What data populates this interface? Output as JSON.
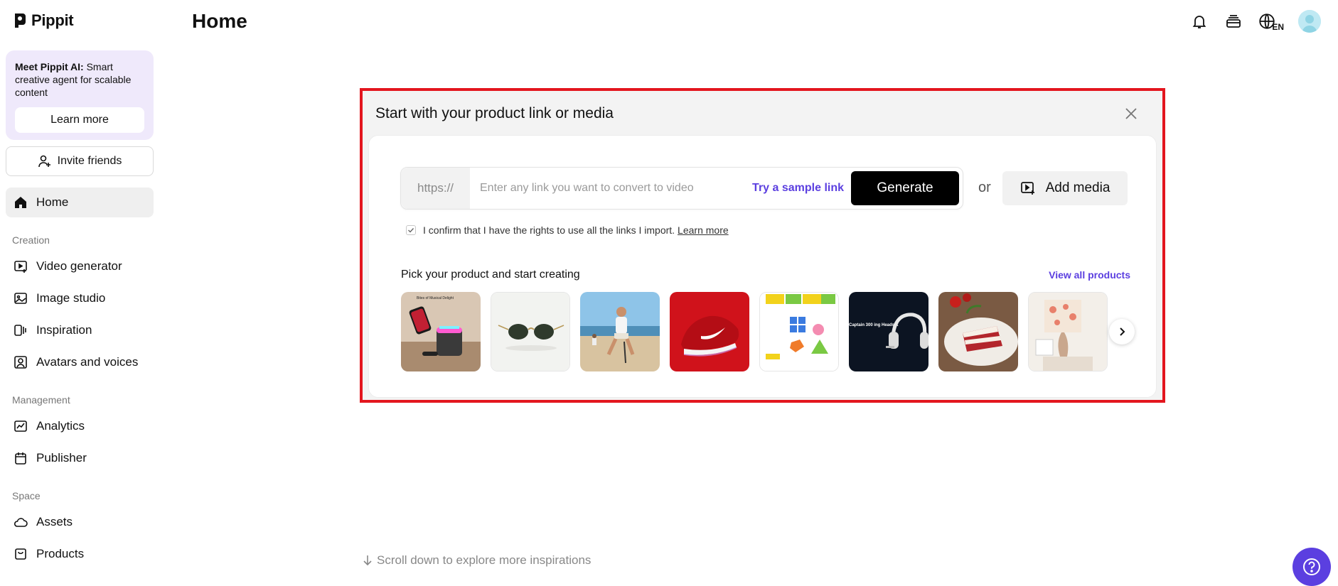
{
  "app": {
    "name": "Pippit"
  },
  "promo": {
    "title": "Meet Pippit AI:",
    "text": " Smart creative agent for scalable content",
    "button": "Learn more"
  },
  "invite": {
    "label": "Invite friends"
  },
  "sidebar": {
    "home": "Home",
    "sections": {
      "creation": "Creation",
      "management": "Management",
      "space": "Space"
    },
    "creation_items": [
      "Video generator",
      "Image studio",
      "Inspiration",
      "Avatars and voices"
    ],
    "management_items": [
      "Analytics",
      "Publisher"
    ],
    "space_items": [
      "Assets",
      "Products"
    ]
  },
  "header": {
    "title": "Home",
    "language": "EN"
  },
  "card": {
    "title": "Start with your product link or media",
    "link_prefix": "https://",
    "link_placeholder": "Enter any link you want to convert to video",
    "sample_link": "Try a sample link",
    "generate": "Generate",
    "or": "or",
    "add_media": "Add media",
    "confirm_text": "I confirm that I have the rights to use all the links I import.",
    "confirm_link": "Learn more",
    "pick_title": "Pick your product and start creating",
    "view_all": "View all products",
    "products": [
      {
        "name": "speaker",
        "caption": "Bites of Musical Delight"
      },
      {
        "name": "sunglasses"
      },
      {
        "name": "beach-person"
      },
      {
        "name": "red-sneaker"
      },
      {
        "name": "shape-toy"
      },
      {
        "name": "headset",
        "caption": "Captain 300 ing Headset"
      },
      {
        "name": "cake"
      },
      {
        "name": "lamp"
      }
    ]
  },
  "footer": {
    "scroll_hint": "Scroll down to explore more inspirations"
  },
  "colors": {
    "accent": "#5b3fe0",
    "highlight_frame": "#e3161e",
    "promo_bg": "#efe9fb"
  }
}
